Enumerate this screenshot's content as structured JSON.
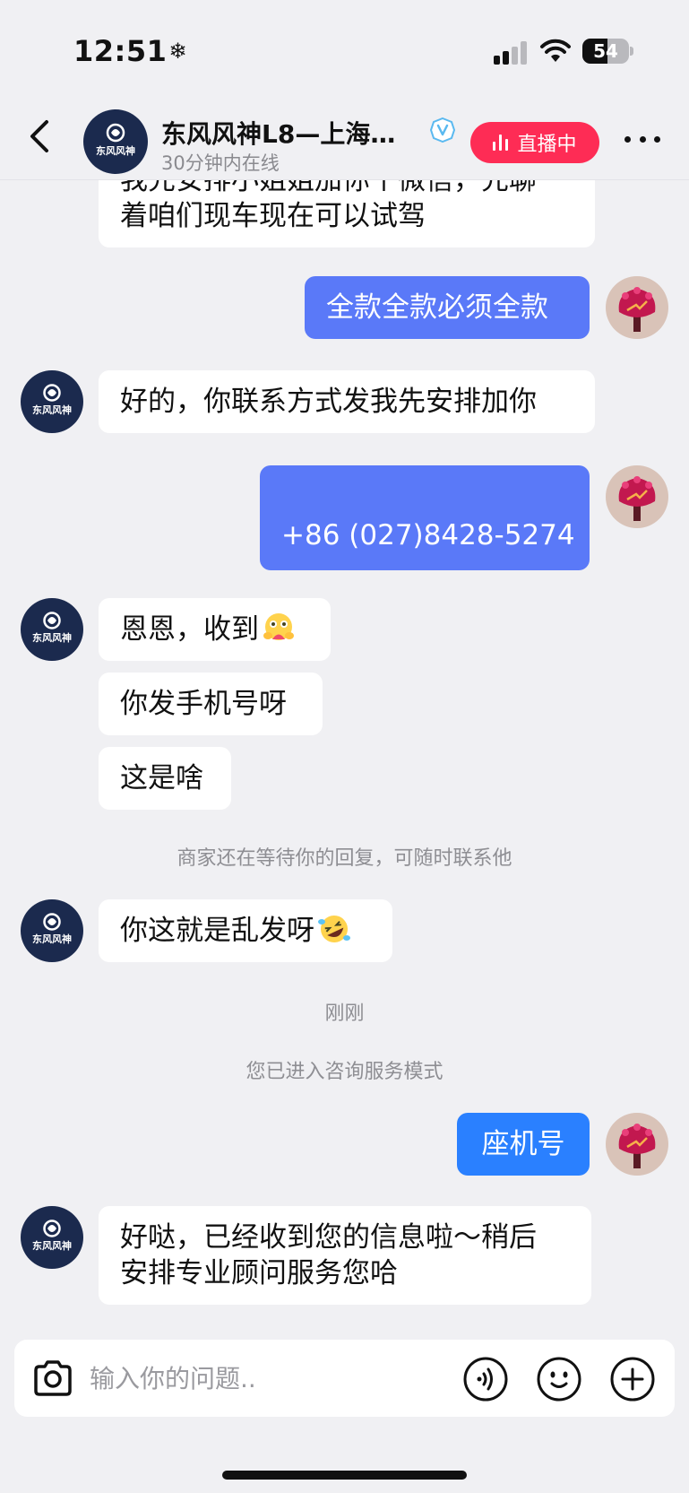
{
  "status_bar": {
    "time": "12:51",
    "battery": "54",
    "battery_level": 0.54
  },
  "header": {
    "title": "东风风神L8—上海…",
    "subtitle": "30分钟内在线",
    "live_label": "直播中",
    "brand_logo_text": "东风风神"
  },
  "messages": [
    {
      "side": "in",
      "text_lines": [
        "我先安排小姐姐加你个微信，先聊",
        "着咱们现车现在可以试驾"
      ]
    },
    {
      "side": "out",
      "text": "全款全款必须全款"
    },
    {
      "side": "in",
      "text": "好的，你联系方式发我先安排加你"
    },
    {
      "side": "out",
      "text": "+86 (027)8428-5274"
    },
    {
      "side": "in",
      "text": "恩恩，收到",
      "emoji": "hugging-face"
    },
    {
      "side": "in",
      "text": "你发手机号呀"
    },
    {
      "side": "in",
      "text": "这是啥"
    },
    {
      "side": "system",
      "text": "商家还在等待你的回复，可随时联系他"
    },
    {
      "side": "in",
      "text": "你这就是乱发呀",
      "emoji": "rolling-laughing-face"
    },
    {
      "side": "system",
      "text": "刚刚"
    },
    {
      "side": "system",
      "text": "您已进入咨询服务模式"
    },
    {
      "side": "out",
      "text": "座机号"
    },
    {
      "side": "in",
      "text_lines": [
        "好哒，已经收到您的信息啦～稍后",
        "安排专业顾问服务您哈"
      ]
    }
  ],
  "input": {
    "placeholder": "输入你的问题.."
  },
  "colors": {
    "background": "#f0f0f3",
    "out_bubble_purple": "#5a79f8",
    "out_bubble_blue": "#2a80ff",
    "live_red": "#fe2c55",
    "brand_navy": "#1b2a4e"
  }
}
